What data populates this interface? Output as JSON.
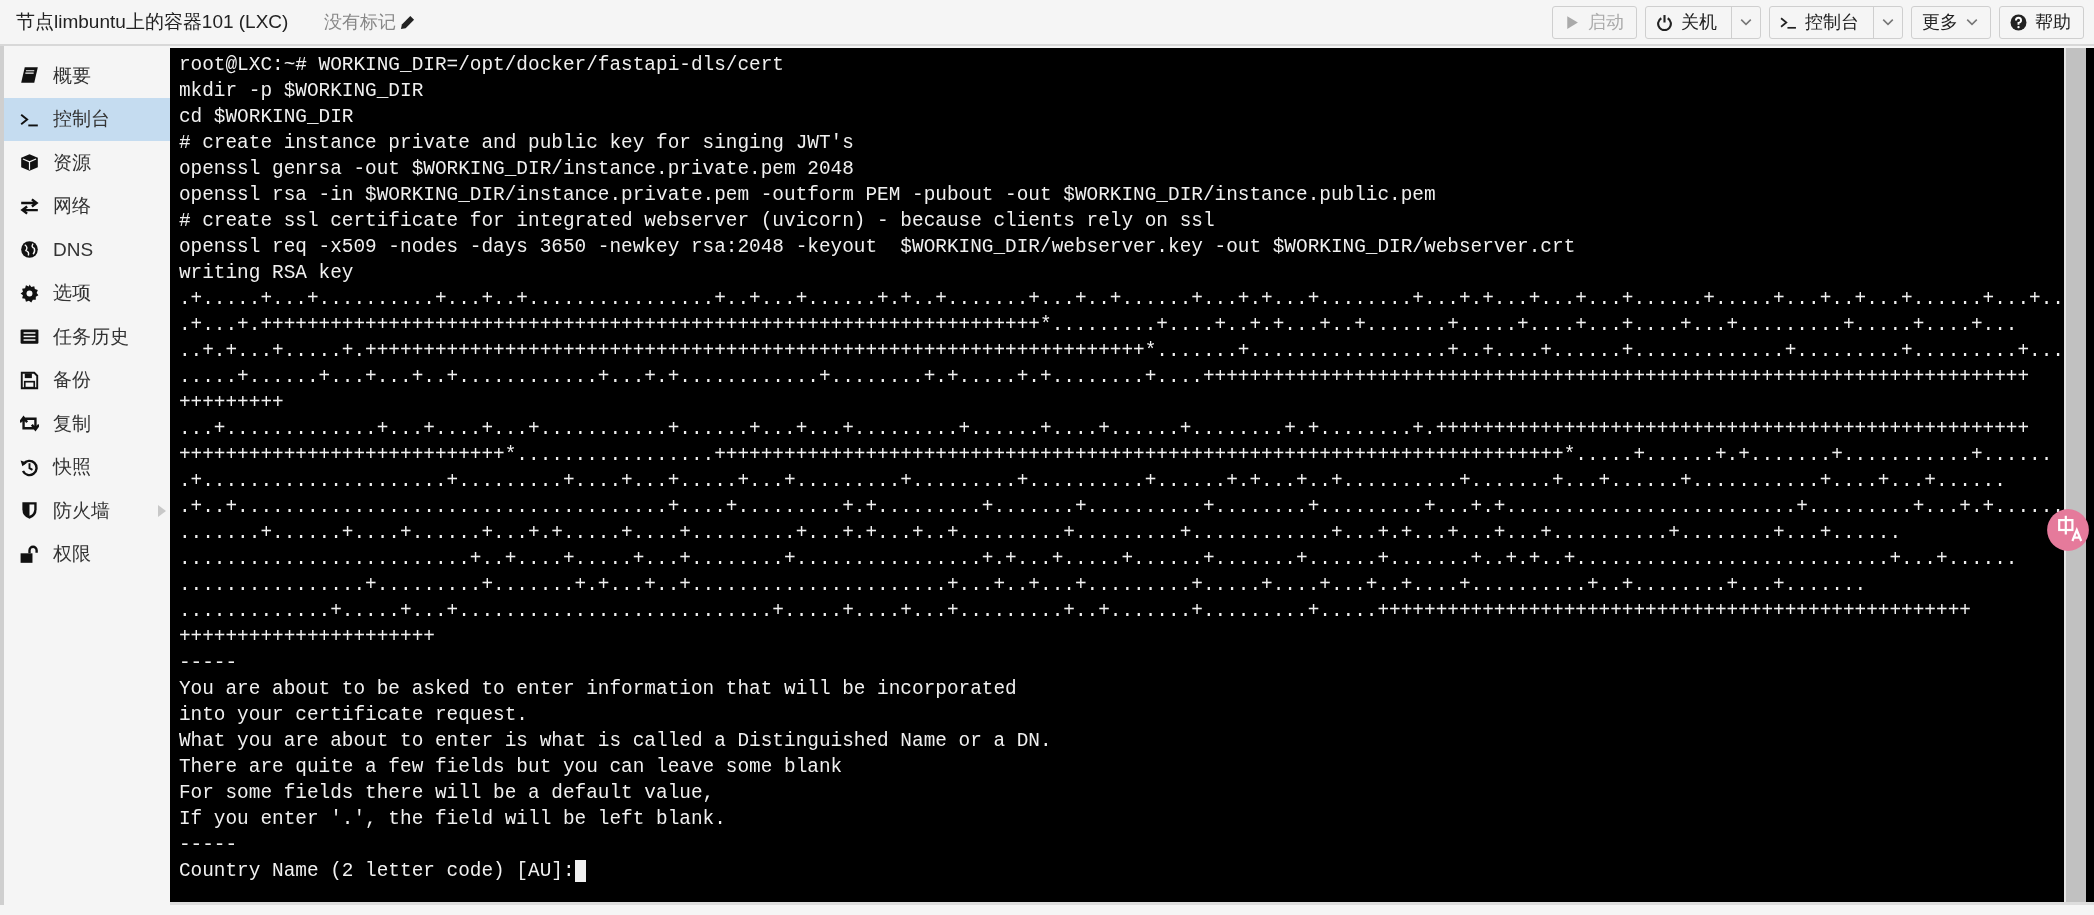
{
  "header": {
    "title": "节点limbuntu上的容器101 (LXC)",
    "tags": "没有标记",
    "buttons": [
      {
        "label": "启动",
        "kind": "play",
        "disabled": true,
        "split": false
      },
      {
        "label": "关机",
        "kind": "power",
        "disabled": false,
        "split": true
      },
      {
        "label": "控制台",
        "kind": "terminal",
        "disabled": false,
        "split": true
      },
      {
        "label": "更多",
        "kind": "menu",
        "disabled": false,
        "split": false,
        "caret": true
      },
      {
        "label": "帮助",
        "kind": "help",
        "disabled": false,
        "split": false
      }
    ]
  },
  "sidebar": {
    "items": [
      {
        "label": "概要",
        "kind": "book",
        "selected": false
      },
      {
        "label": "控制台",
        "kind": "terminal",
        "selected": true
      },
      {
        "label": "资源",
        "kind": "cube",
        "selected": false
      },
      {
        "label": "网络",
        "kind": "exchange",
        "selected": false
      },
      {
        "label": "DNS",
        "kind": "globe",
        "selected": false
      },
      {
        "label": "选项",
        "kind": "gear",
        "selected": false
      },
      {
        "label": "任务历史",
        "kind": "list",
        "selected": false
      },
      {
        "label": "备份",
        "kind": "floppy",
        "selected": false
      },
      {
        "label": "复制",
        "kind": "retweet",
        "selected": false
      },
      {
        "label": "快照",
        "kind": "history",
        "selected": false
      },
      {
        "label": "防火墙",
        "kind": "shield",
        "selected": false,
        "expandable": true
      },
      {
        "label": "权限",
        "kind": "unlock",
        "selected": false
      }
    ]
  },
  "terminal": {
    "lines": [
      "root@LXC:~# WORKING_DIR=/opt/docker/fastapi-dls/cert",
      "mkdir -p $WORKING_DIR",
      "cd $WORKING_DIR",
      "# create instance private and public key for singing JWT's",
      "openssl genrsa -out $WORKING_DIR/instance.private.pem 2048",
      "openssl rsa -in $WORKING_DIR/instance.private.pem -outform PEM -pubout -out $WORKING_DIR/instance.public.pem",
      "# create ssl certificate for integrated webserver (uvicorn) - because clients rely on ssl",
      "openssl req -x509 -nodes -days 3650 -newkey rsa:2048 -keyout  $WORKING_DIR/webserver.key -out $WORKING_DIR/webserver.crt",
      "writing RSA key",
      ".+.....+...+..........+...+..+................+..+...+......+.+..+.......+...+..+......+...+.+...+........+...+.+...+...+...+......+.....+...+..+...+......+...+..",
      ".+...+.+++++++++++++++++++++++++++++++++++++++++++++++++++++++++++++++++++*.........+....+..+.+...+..+.......+.....+....+...+....+...+.........+.....+....+...",
      "..+.+...+.....+.+++++++++++++++++++++++++++++++++++++++++++++++++++++++++++++++++++*.......+.................+..+....+......+.............+.........+.........+...",
      ".....+......+...+...+..+............+...+.+............+........+.+.....+.+........+....+++++++++++++++++++++++++++++++++++++++++++++++++++++++++++++++++++++++",
      "+++++++++",
      "...+.............+...+....+...+...........+......+...+...+.........+......+....+......+........+.+........+.+++++++++++++++++++++++++++++++++++++++++++++++++++",
      "++++++++++++++++++++++++++++*.................+++++++++++++++++++++++++++++++++++++++++++++++++++++++++++++++++++++++++*.....+......+.+.......+...........+......",
      ".+.....................+.........+....+...+.....+...+.........+.........+..........+......+.+...+..+..........+.......+...+......+...........+....+...+......",
      ".+..+.....................................+....+.........+.+.........+.......+..........+........+.........+...+.+.........................+.........+...+.+......",
      ".......+......+....+......+...+.+.....+....+.........+...+.+...+..+.........+.........+............+...+.+...+...+...+..........+........+...+......",
      ".........................+..+....+.....+...+........+................+.+...+.....+......+.......+......+.......+..+.+..+...........................+...+......",
      "................+.........+.......+.+...+..+......................+...+..+...+.........+.....+....+...+..+....+..........+..+........+...+.......",
      ".............+.....+...+...........................+.....+....+...+.........+..+.......+.........+.....+++++++++++++++++++++++++++++++++++++++++++++++++++",
      "++++++++++++++++++++++",
      "-----",
      "You are about to be asked to enter information that will be incorporated",
      "into your certificate request.",
      "What you are about to enter is what is called a Distinguished Name or a DN.",
      "There are quite a few fields but you can leave some blank",
      "For some fields there will be a default value,",
      "If you enter '.', the field will be left blank.",
      "-----",
      "Country Name (2 letter code) [AU]:"
    ]
  }
}
